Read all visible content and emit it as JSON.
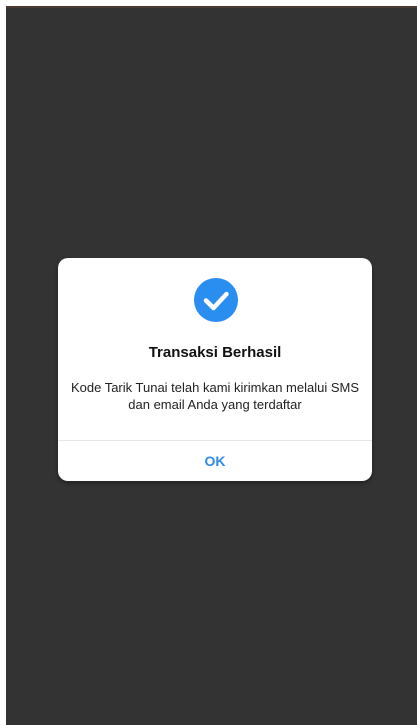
{
  "colors": {
    "overlay": "#333333",
    "dialog_background": "#ffffff",
    "accent": "#2f8be6",
    "check_circle": "#2a8ef0"
  },
  "dialog": {
    "icon": "check-circle-icon",
    "title": "Transaksi Berhasil",
    "message": "Kode Tarik Tunai telah kami kirimkan melalui SMS dan email Anda yang terdaftar",
    "ok_label": "OK"
  }
}
